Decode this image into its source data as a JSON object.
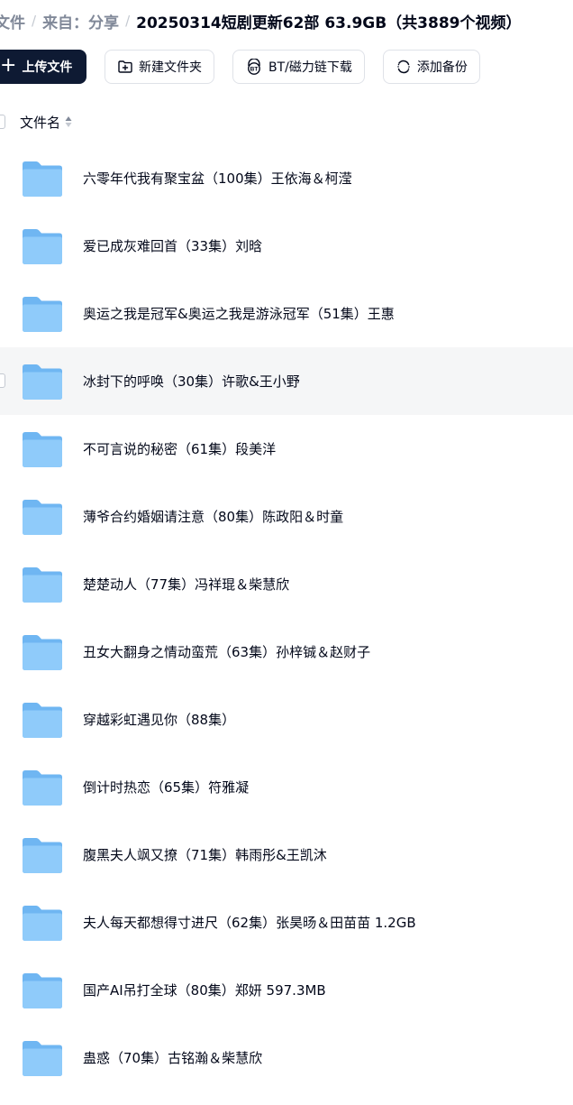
{
  "breadcrumb": {
    "root": "文件",
    "source": "来自：分享",
    "current": "20250314短剧更新62部 63.9GB（共3889个视频）"
  },
  "toolbar": {
    "upload_label": "上传文件",
    "new_folder_label": "新建文件夹",
    "bt_label": "BT/磁力链下载",
    "backup_label": "添加备份"
  },
  "list_header": {
    "name_label": "文件名"
  },
  "files": [
    {
      "name": "六零年代我有聚宝盆（100集）王依海＆柯滢"
    },
    {
      "name": "爱已成灰难回首（33集）刘晗"
    },
    {
      "name": "奥运之我是冠军&奥运之我是游泳冠军（51集）王惠"
    },
    {
      "name": "冰封下的呼唤（30集）许歌&王小野"
    },
    {
      "name": "不可言说的秘密（61集）段美洋"
    },
    {
      "name": "薄爷合约婚姻请注意（80集）陈政阳＆时童"
    },
    {
      "name": "楚楚动人（77集）冯祥琨＆柴慧欣"
    },
    {
      "name": "丑女大翻身之情动蛮荒（63集）孙梓铖＆赵财子"
    },
    {
      "name": "穿越彩虹遇见你（88集）"
    },
    {
      "name": "倒计时热恋（65集）符雅凝"
    },
    {
      "name": "腹黑夫人飒又撩（71集）韩雨彤&王凯沐"
    },
    {
      "name": "夫人每天都想得寸进尺（62集）张昊旸＆田苗苗 1.2GB"
    },
    {
      "name": "国产AI吊打全球（80集）郑妍  597.3MB"
    },
    {
      "name": "蛊惑（70集）古铭瀚＆柴慧欣"
    }
  ],
  "hovered_row_index": 3,
  "colors": {
    "primary_button": "#0e1a33",
    "folder": "#7cc1f7",
    "hover_row": "#f5f6f7",
    "text": "#03081a",
    "breadcrumb_link": "#818999"
  }
}
